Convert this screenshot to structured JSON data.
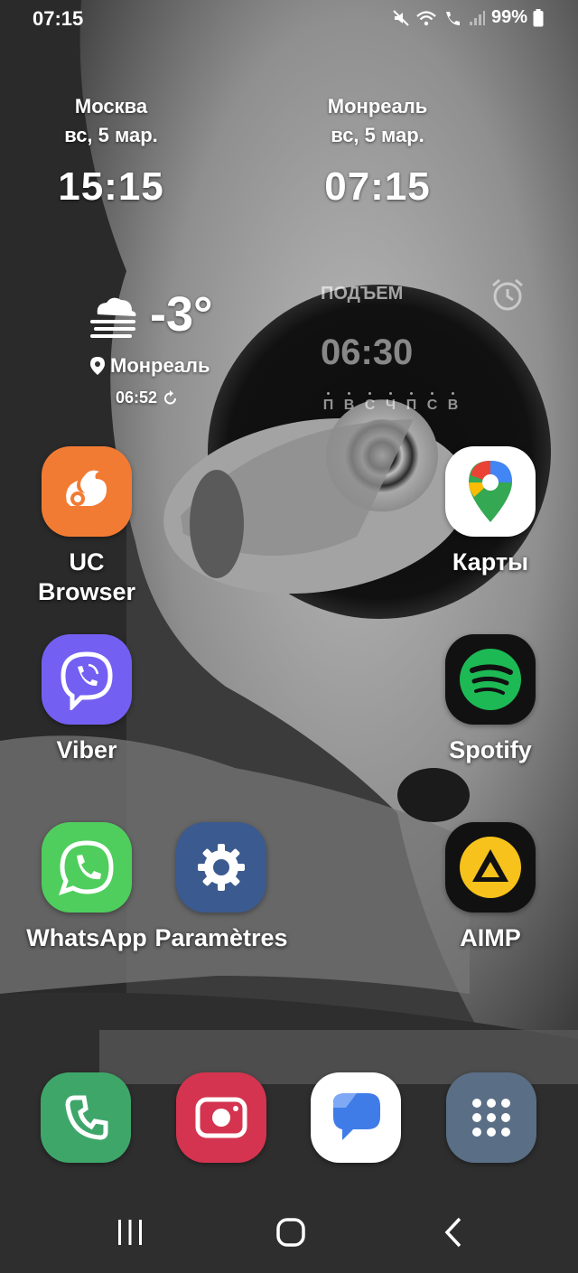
{
  "status_bar": {
    "time": "07:15",
    "battery_percent": "99%",
    "icons": [
      "mute-icon",
      "wifi-call-icon",
      "volte-call-icon",
      "signal-icon",
      "battery-icon"
    ]
  },
  "clocks": [
    {
      "city": "Москва",
      "date": "вс, 5 мар.",
      "time": "15:15"
    },
    {
      "city": "Монреаль",
      "date": "вс, 5 мар.",
      "time": "07:15"
    }
  ],
  "weather": {
    "temperature": "-3°",
    "location": "Монреаль",
    "updated": "06:52",
    "icon": "cloud-fog-icon"
  },
  "alarm": {
    "label": "ПОДЪЕМ",
    "time": "06:30",
    "days": [
      "П",
      "В",
      "С",
      "Ч",
      "П",
      "С",
      "В"
    ],
    "enabled": false
  },
  "apps": {
    "uc_browser": {
      "label": "UC Browser",
      "color": "#f27b34"
    },
    "maps": {
      "label": "Карты",
      "color": "#ffffff"
    },
    "viber": {
      "label": "Viber",
      "color": "#7360f2"
    },
    "spotify": {
      "label": "Spotify",
      "color": "#1db954"
    },
    "whatsapp": {
      "label": "WhatsApp",
      "color": "#4fce5d"
    },
    "parametres": {
      "label": "Paramètres",
      "color": "#3b5a8f"
    },
    "aimp": {
      "label": "AIMP",
      "color": "#f6c21b"
    }
  },
  "dock": [
    {
      "name": "phone",
      "color": "#3fa66a"
    },
    {
      "name": "camera",
      "color": "#d4344f"
    },
    {
      "name": "messages",
      "color": "#ffffff"
    },
    {
      "name": "app-drawer",
      "color": "#5a6f86"
    }
  ],
  "nav": [
    "recents-icon",
    "home-icon",
    "back-icon"
  ]
}
